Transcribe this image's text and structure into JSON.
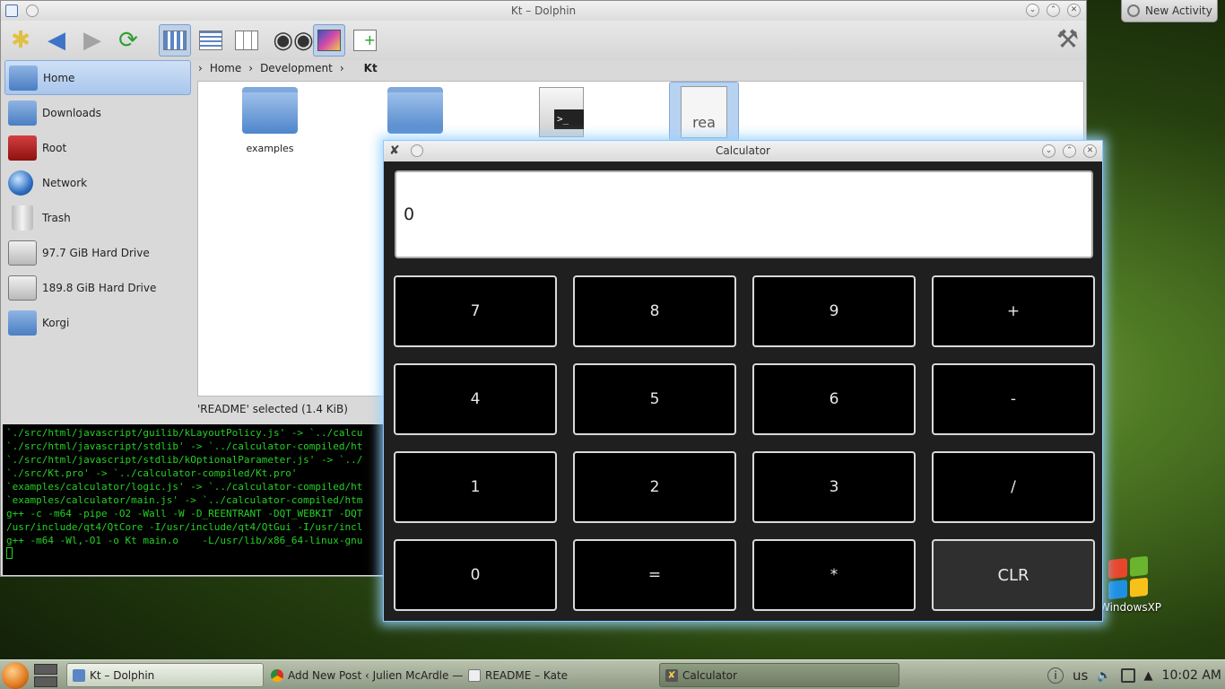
{
  "desktop": {
    "new_activity_label": "New Activity",
    "icon_label": "WindowsXP"
  },
  "dolphin": {
    "title": "Kt – Dolphin",
    "places": [
      {
        "label": "Home",
        "icon": "home-folder-icon"
      },
      {
        "label": "Downloads",
        "icon": "downloads-folder-icon"
      },
      {
        "label": "Root",
        "icon": "root-folder-icon"
      },
      {
        "label": "Network",
        "icon": "network-globe-icon"
      },
      {
        "label": "Trash",
        "icon": "trash-icon"
      },
      {
        "label": "97.7 GiB Hard Drive",
        "icon": "hard-drive-icon"
      },
      {
        "label": "189.8 GiB Hard Drive",
        "icon": "hard-drive-icon"
      },
      {
        "label": "Korgi",
        "icon": "korgi-folder-icon"
      }
    ],
    "breadcrumb": [
      "Home",
      "Development",
      "Kt"
    ],
    "files": [
      {
        "name": "examples",
        "icon": "folder-icon"
      },
      {
        "name": "",
        "icon": "folder-icon"
      },
      {
        "name": "",
        "icon": "script-icon"
      },
      {
        "name": "rea",
        "icon": "readme-icon"
      }
    ],
    "status": "'README' selected (1.4 KiB)"
  },
  "terminal": {
    "lines": [
      "`./src/html/javascript/guilib/kLayoutPolicy.js' -> `../calcu",
      "`./src/html/javascript/stdlib' -> `../calculator-compiled/ht",
      "`./src/html/javascript/stdlib/kOptionalParameter.js' -> `../",
      "`./src/Kt.pro' -> `../calculator-compiled/Kt.pro'",
      "`examples/calculator/logic.js' -> `../calculator-compiled/ht",
      "`examples/calculator/main.js' -> `../calculator-compiled/htm",
      "g++ -c -m64 -pipe -O2 -Wall -W -D_REENTRANT -DQT_WEBKIT -DQT",
      "/usr/include/qt4/QtCore -I/usr/include/qt4/QtGui -I/usr/incl",
      "g++ -m64 -Wl,-O1 -o Kt main.o    -L/usr/lib/x86_64-linux-gnu"
    ]
  },
  "calculator": {
    "title": "Calculator",
    "display": "0",
    "keys": [
      "7",
      "8",
      "9",
      "+",
      "4",
      "5",
      "6",
      "-",
      "1",
      "2",
      "3",
      "/",
      "0",
      "=",
      "*",
      "CLR"
    ]
  },
  "taskbar": {
    "tasks": [
      {
        "label": "Kt – Dolphin",
        "icon": "dolphin-icon"
      },
      {
        "label": "Add New Post ‹ Julien McArdle — Wo",
        "icon": "chrome-icon"
      },
      {
        "label": "README – Kate",
        "icon": "kate-icon"
      },
      {
        "label": "Calculator",
        "icon": "calculator-icon"
      }
    ],
    "keyboard_layout": "us",
    "clock": "10:02 AM"
  }
}
